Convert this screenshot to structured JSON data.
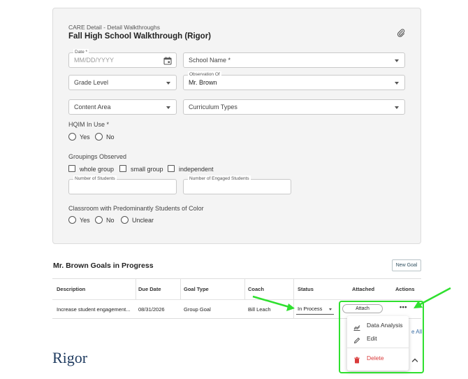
{
  "form": {
    "subtitle": "CARE Detail - Detail Walkthroughs",
    "title": "Fall High School Walkthrough (Rigor)",
    "date": {
      "label": "Date *",
      "placeholder": "MM/DD/YYYY"
    },
    "school": {
      "value": "School Name *"
    },
    "grade": {
      "value": "Grade Level"
    },
    "observation": {
      "label": "Observation Of",
      "value": "Mr. Brown"
    },
    "content_area": {
      "value": "Content Area"
    },
    "curriculum": {
      "value": "Curriculum Types"
    },
    "hqim": {
      "label": "HQIM In Use *",
      "options": [
        "Yes",
        "No"
      ]
    },
    "groupings": {
      "label": "Groupings Observed",
      "options": [
        "whole group",
        "small group",
        "independent"
      ]
    },
    "num_students": {
      "label": "Number of Students",
      "value": ""
    },
    "num_engaged": {
      "label": "Number of Engaged Students",
      "value": ""
    },
    "classroom": {
      "label": "Classroom with Predominantly Students of Color",
      "options": [
        "Yes",
        "No",
        "Unclear"
      ]
    }
  },
  "goals": {
    "title": "Mr. Brown Goals in Progress",
    "new_goal": "New Goal",
    "columns": [
      "Description",
      "Due Date",
      "Goal Type",
      "Coach",
      "Status",
      "Attached",
      "Actions"
    ],
    "rows": [
      {
        "description": "Increase student engagement...",
        "due_date": "08/31/2026",
        "goal_type": "Group Goal",
        "coach": "Bill Leach",
        "status": "In Process",
        "attach_label": "Attach"
      }
    ],
    "see_all": "e All"
  },
  "menu": {
    "items": [
      {
        "label": "Data Analysis",
        "icon": "chart-icon"
      },
      {
        "label": "Edit",
        "icon": "pencil-icon"
      },
      {
        "label": "Delete",
        "icon": "trash-icon"
      }
    ]
  },
  "section": {
    "title": "Rigor"
  },
  "colors": {
    "highlight": "#2fe02f",
    "delete": "#d93a3a",
    "heading": "#1e3a5f"
  }
}
